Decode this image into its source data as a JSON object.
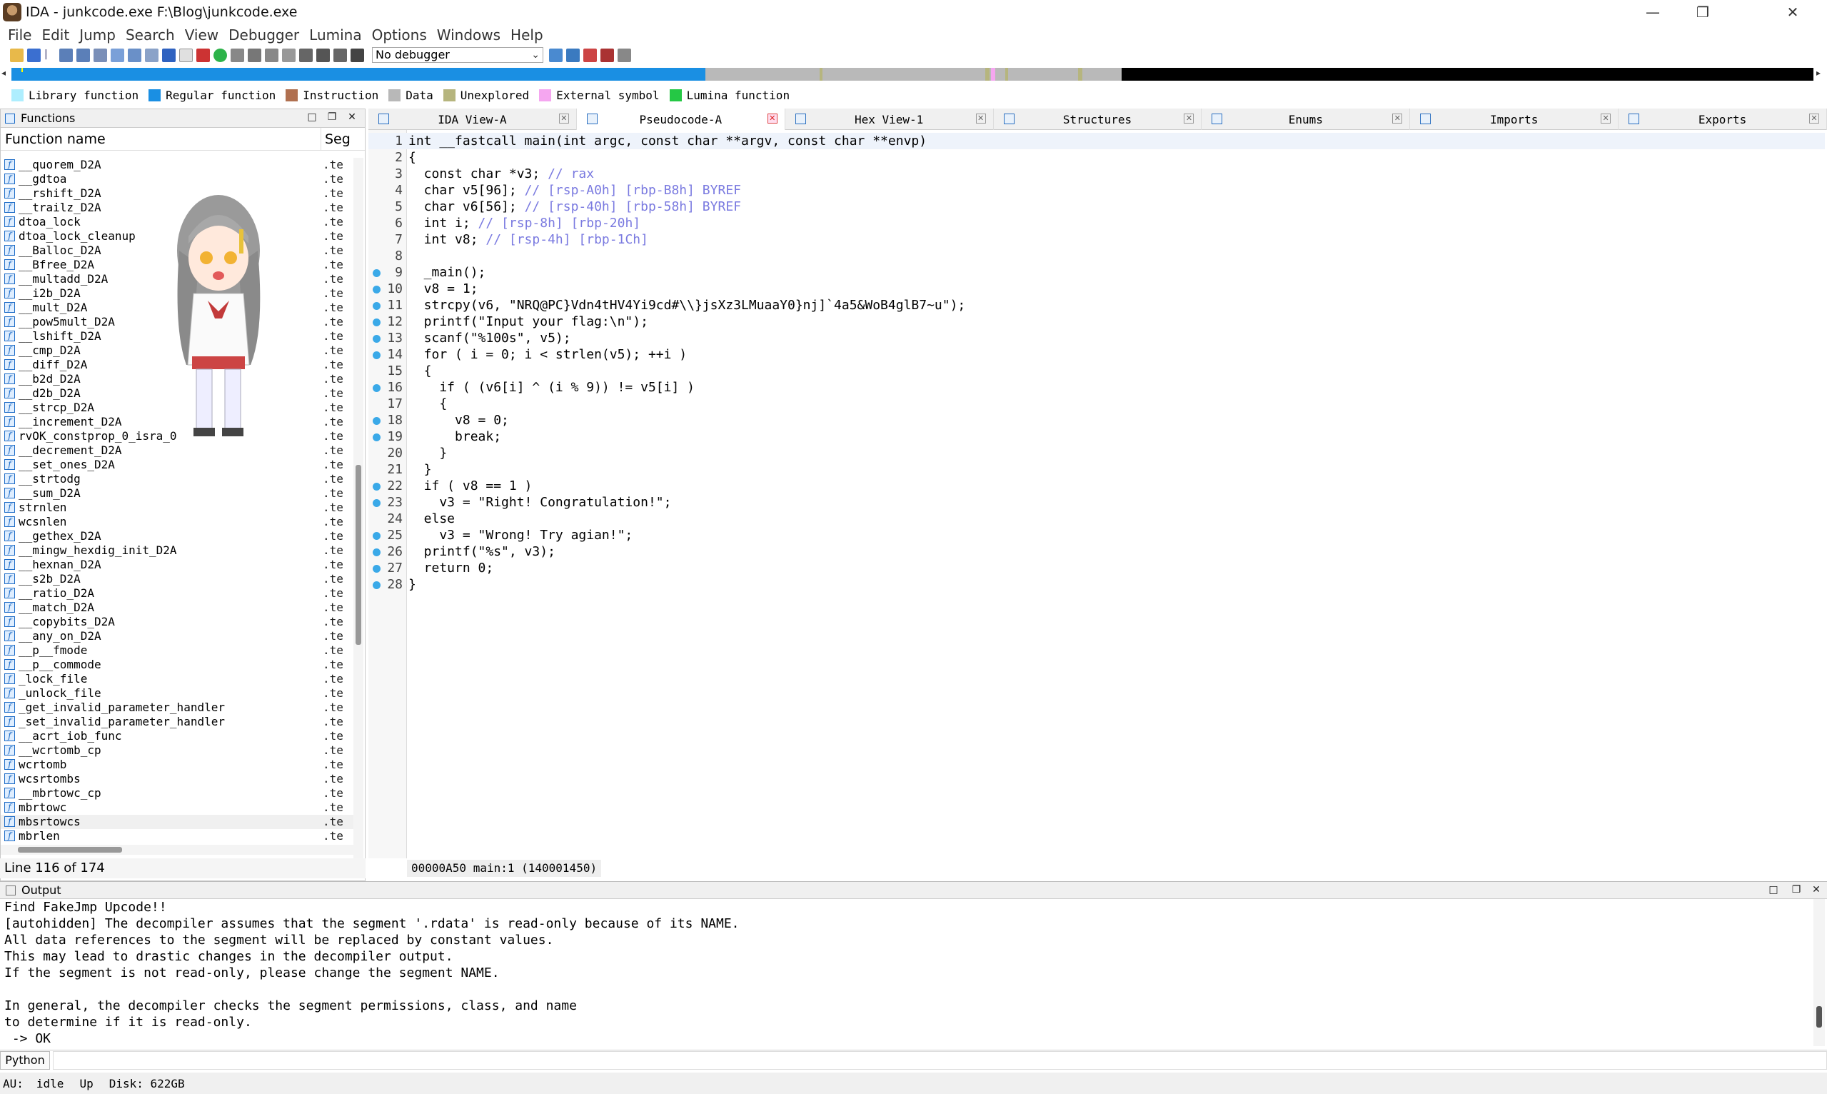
{
  "window": {
    "title": "IDA - junkcode.exe F:\\Blog\\junkcode.exe",
    "minimize": "—",
    "maximize": "❐",
    "close": "✕"
  },
  "menu": [
    "File",
    "Edit",
    "Jump",
    "Search",
    "View",
    "Debugger",
    "Lumina",
    "Options",
    "Windows",
    "Help"
  ],
  "toolbar": {
    "debugger": "No debugger"
  },
  "legend": [
    {
      "label": "Library function",
      "color": "#aeeefe"
    },
    {
      "label": "Regular function",
      "color": "#1a8fe3"
    },
    {
      "label": "Instruction",
      "color": "#b07050"
    },
    {
      "label": "Data",
      "color": "#b8b8b8"
    },
    {
      "label": "Unexplored",
      "color": "#b6b57e"
    },
    {
      "label": "External symbol",
      "color": "#f5a6f0"
    },
    {
      "label": "Lumina function",
      "color": "#25c845"
    }
  ],
  "functions": {
    "title": "Functions",
    "col_name": "Function name",
    "col_seg": "Seg",
    "rows": [
      {
        "name": "__quorem_D2A",
        "seg": ".te"
      },
      {
        "name": "__gdtoa",
        "seg": ".te"
      },
      {
        "name": "__rshift_D2A",
        "seg": ".te"
      },
      {
        "name": "__trailz_D2A",
        "seg": ".te"
      },
      {
        "name": "dtoa_lock",
        "seg": ".te"
      },
      {
        "name": "dtoa_lock_cleanup",
        "seg": ".te"
      },
      {
        "name": "__Balloc_D2A",
        "seg": ".te"
      },
      {
        "name": "__Bfree_D2A",
        "seg": ".te"
      },
      {
        "name": "__multadd_D2A",
        "seg": ".te"
      },
      {
        "name": "__i2b_D2A",
        "seg": ".te"
      },
      {
        "name": "__mult_D2A",
        "seg": ".te"
      },
      {
        "name": "__pow5mult_D2A",
        "seg": ".te"
      },
      {
        "name": "__lshift_D2A",
        "seg": ".te"
      },
      {
        "name": "__cmp_D2A",
        "seg": ".te"
      },
      {
        "name": "__diff_D2A",
        "seg": ".te"
      },
      {
        "name": "__b2d_D2A",
        "seg": ".te"
      },
      {
        "name": "__d2b_D2A",
        "seg": ".te"
      },
      {
        "name": "__strcp_D2A",
        "seg": ".te"
      },
      {
        "name": "__increment_D2A",
        "seg": ".te"
      },
      {
        "name": "rvOK_constprop_0_isra_0",
        "seg": ".te"
      },
      {
        "name": "__decrement_D2A",
        "seg": ".te"
      },
      {
        "name": "__set_ones_D2A",
        "seg": ".te"
      },
      {
        "name": "__strtodg",
        "seg": ".te"
      },
      {
        "name": "__sum_D2A",
        "seg": ".te"
      },
      {
        "name": "strnlen",
        "seg": ".te"
      },
      {
        "name": "wcsnlen",
        "seg": ".te"
      },
      {
        "name": "__gethex_D2A",
        "seg": ".te"
      },
      {
        "name": "__mingw_hexdig_init_D2A",
        "seg": ".te"
      },
      {
        "name": "__hexnan_D2A",
        "seg": ".te"
      },
      {
        "name": "__s2b_D2A",
        "seg": ".te"
      },
      {
        "name": "__ratio_D2A",
        "seg": ".te"
      },
      {
        "name": "__match_D2A",
        "seg": ".te"
      },
      {
        "name": "__copybits_D2A",
        "seg": ".te"
      },
      {
        "name": "__any_on_D2A",
        "seg": ".te"
      },
      {
        "name": "__p__fmode",
        "seg": ".te"
      },
      {
        "name": "__p__commode",
        "seg": ".te"
      },
      {
        "name": "_lock_file",
        "seg": ".te"
      },
      {
        "name": "_unlock_file",
        "seg": ".te"
      },
      {
        "name": "_get_invalid_parameter_handler",
        "seg": ".te"
      },
      {
        "name": "_set_invalid_parameter_handler",
        "seg": ".te"
      },
      {
        "name": "__acrt_iob_func",
        "seg": ".te"
      },
      {
        "name": "__wcrtomb_cp",
        "seg": ".te"
      },
      {
        "name": "wcrtomb",
        "seg": ".te"
      },
      {
        "name": "wcsrtombs",
        "seg": ".te"
      },
      {
        "name": "__mbrtowc_cp",
        "seg": ".te"
      },
      {
        "name": "mbrtowc",
        "seg": ".te"
      },
      {
        "name": "mbsrtowcs",
        "seg": ".te"
      },
      {
        "name": "mbrlen",
        "seg": ".te"
      }
    ],
    "status": "Line 116 of 174"
  },
  "tabs": [
    {
      "label": "IDA View-A",
      "active": false
    },
    {
      "label": "Pseudocode-A",
      "active": true
    },
    {
      "label": "Hex View-1",
      "active": false
    },
    {
      "label": "Structures",
      "active": false
    },
    {
      "label": "Enums",
      "active": false
    },
    {
      "label": "Imports",
      "active": false
    },
    {
      "label": "Exports",
      "active": false
    }
  ],
  "code": [
    {
      "n": "1",
      "bp": false,
      "t": "int __fastcall main(int argc, const char **argv, const char **envp)"
    },
    {
      "n": "2",
      "bp": false,
      "t": "{"
    },
    {
      "n": "3",
      "bp": false,
      "t": "  const char *v3; // rax"
    },
    {
      "n": "4",
      "bp": false,
      "t": "  char v5[96]; // [rsp-A0h] [rbp-B8h] BYREF"
    },
    {
      "n": "5",
      "bp": false,
      "t": "  char v6[56]; // [rsp-40h] [rbp-58h] BYREF"
    },
    {
      "n": "6",
      "bp": false,
      "t": "  int i; // [rsp-8h] [rbp-20h]"
    },
    {
      "n": "7",
      "bp": false,
      "t": "  int v8; // [rsp-4h] [rbp-1Ch]"
    },
    {
      "n": "8",
      "bp": false,
      "t": ""
    },
    {
      "n": "9",
      "bp": true,
      "t": "  _main();"
    },
    {
      "n": "10",
      "bp": true,
      "t": "  v8 = 1;"
    },
    {
      "n": "11",
      "bp": true,
      "t": "  strcpy(v6, \"NRQ@PC}Vdn4tHV4Yi9cd#\\\\}jsXz3LMuaaY0}nj]`4a5&WoB4glB7~u\");"
    },
    {
      "n": "12",
      "bp": true,
      "t": "  printf(\"Input your flag:\\n\");"
    },
    {
      "n": "13",
      "bp": true,
      "t": "  scanf(\"%100s\", v5);"
    },
    {
      "n": "14",
      "bp": true,
      "t": "  for ( i = 0; i < strlen(v5); ++i )"
    },
    {
      "n": "15",
      "bp": false,
      "t": "  {"
    },
    {
      "n": "16",
      "bp": true,
      "t": "    if ( (v6[i] ^ (i % 9)) != v5[i] )"
    },
    {
      "n": "17",
      "bp": false,
      "t": "    {"
    },
    {
      "n": "18",
      "bp": true,
      "t": "      v8 = 0;"
    },
    {
      "n": "19",
      "bp": true,
      "t": "      break;"
    },
    {
      "n": "20",
      "bp": false,
      "t": "    }"
    },
    {
      "n": "21",
      "bp": false,
      "t": "  }"
    },
    {
      "n": "22",
      "bp": true,
      "t": "  if ( v8 == 1 )"
    },
    {
      "n": "23",
      "bp": true,
      "t": "    v3 = \"Right! Congratulation!\";"
    },
    {
      "n": "24",
      "bp": false,
      "t": "  else"
    },
    {
      "n": "25",
      "bp": true,
      "t": "    v3 = \"Wrong! Try agian!\";"
    },
    {
      "n": "26",
      "bp": true,
      "t": "  printf(\"%s\", v3);"
    },
    {
      "n": "27",
      "bp": true,
      "t": "  return 0;"
    },
    {
      "n": "28",
      "bp": true,
      "t": "}"
    }
  ],
  "code_status": "00000A50 main:1 (140001450)",
  "output": {
    "title": "Output",
    "lines": [
      "Find FakeJmp Upcode!!",
      "[autohidden] The decompiler assumes that the segment '.rdata' is read-only because of its NAME.",
      "All data references to the segment will be replaced by constant values.",
      "This may lead to drastic changes in the decompiler output.",
      "If the segment is not read-only, please change the segment NAME.",
      "",
      "In general, the decompiler checks the segment permissions, class, and name",
      "to determine if it is read-only.",
      " -> OK"
    ]
  },
  "python_button": "Python",
  "status": {
    "au_label": "AU:",
    "au_value": "idle",
    "dir": "Up",
    "disk": "Disk: 622GB"
  }
}
